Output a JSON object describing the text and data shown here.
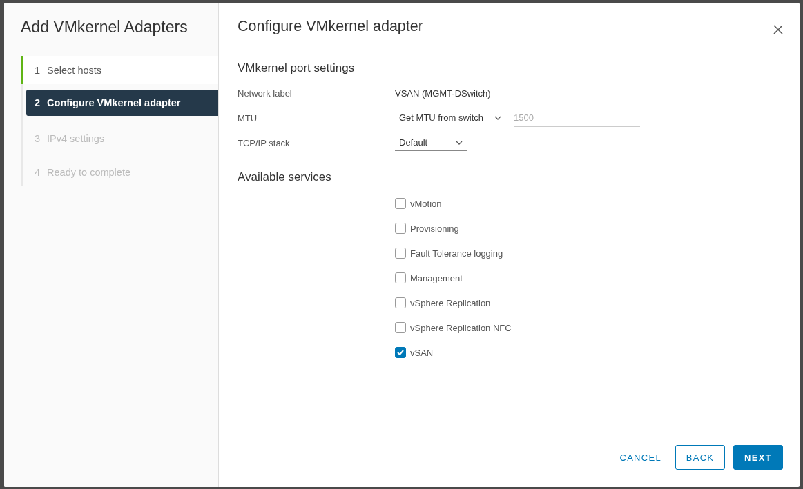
{
  "wizard": {
    "title": "Add VMkernel Adapters",
    "steps": [
      {
        "number": "1",
        "label": "Select hosts",
        "selected": false,
        "disabled": false
      },
      {
        "number": "2",
        "label": "Configure VMkernel adapter",
        "selected": true,
        "disabled": false
      },
      {
        "number": "3",
        "label": "IPv4 settings",
        "selected": false,
        "disabled": true
      },
      {
        "number": "4",
        "label": "Ready to complete",
        "selected": false,
        "disabled": true
      }
    ]
  },
  "page": {
    "title": "Configure VMkernel adapter",
    "port_settings": {
      "heading": "VMkernel port settings",
      "fields": [
        {
          "kind": "text",
          "label": "Network label",
          "value": "VSAN (MGMT-DSwitch)"
        },
        {
          "kind": "mtu",
          "label": "MTU",
          "value": "Get MTU from switch",
          "placeholder": "1500"
        },
        {
          "kind": "select",
          "label": "TCP/IP stack",
          "value": "Default"
        }
      ]
    },
    "services": {
      "heading": "Available services",
      "items": [
        {
          "label": "vMotion",
          "checked": false
        },
        {
          "label": "Provisioning",
          "checked": false
        },
        {
          "label": "Fault Tolerance logging",
          "checked": false
        },
        {
          "label": "Management",
          "checked": false
        },
        {
          "label": "vSphere Replication",
          "checked": false
        },
        {
          "label": "vSphere Replication NFC",
          "checked": false
        },
        {
          "label": "vSAN",
          "checked": true
        }
      ]
    }
  },
  "buttons": [
    {
      "kind": "flat",
      "label": "CANCEL"
    },
    {
      "kind": "outline",
      "label": "BACK"
    },
    {
      "kind": "primary",
      "label": "NEXT"
    }
  ]
}
